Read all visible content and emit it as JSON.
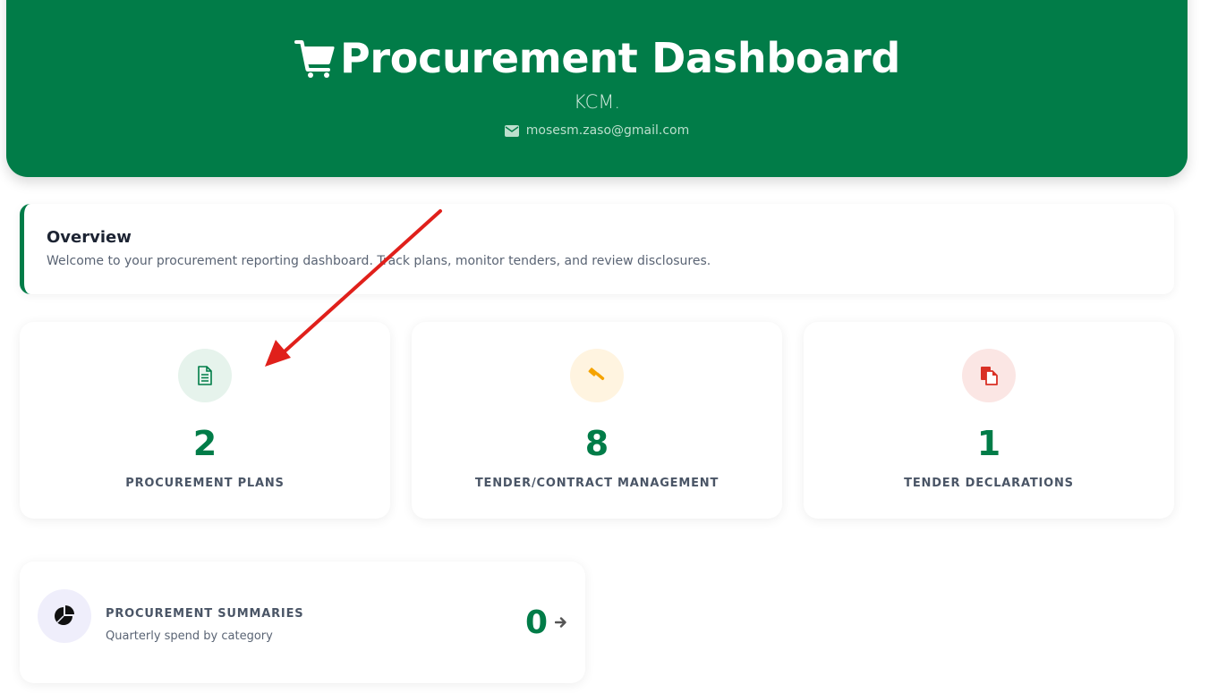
{
  "header": {
    "title": "Procurement Dashboard",
    "organization": "KCM.",
    "email": "mosesm.zaso@gmail.com"
  },
  "overview": {
    "heading": "Overview",
    "text": "Welcome to your procurement reporting dashboard. Track plans, monitor tenders, and review disclosures."
  },
  "cards": [
    {
      "count": "2",
      "label": "PROCUREMENT PLANS",
      "icon": "document-icon",
      "color": "#017c48",
      "bg": "#e6f3ec"
    },
    {
      "count": "8",
      "label": "TENDER/CONTRACT MANAGEMENT",
      "icon": "gavel-icon",
      "color": "#f5a300",
      "bg": "#fff4e0"
    },
    {
      "count": "1",
      "label": "TENDER DECLARATIONS",
      "icon": "copy-icon",
      "color": "#d93025",
      "bg": "#fbe6e4"
    }
  ],
  "summary": {
    "title": "PROCUREMENT SUMMARIES",
    "subtitle": "Quarterly spend by category",
    "count": "0",
    "icon": "pie-chart-icon"
  },
  "colors": {
    "brand": "#017c48",
    "annotation": "#e0201b"
  }
}
